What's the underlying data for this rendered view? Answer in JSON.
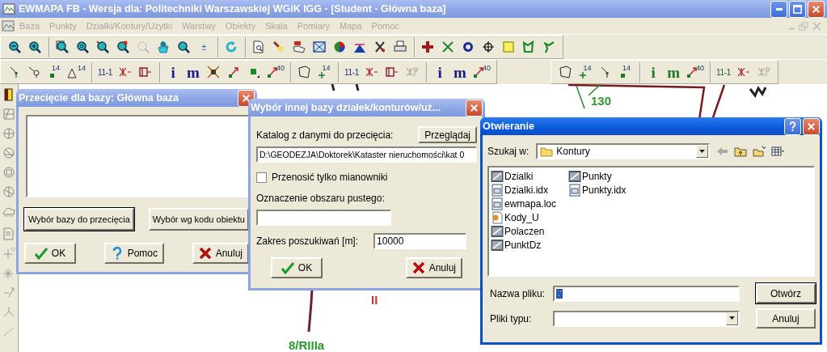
{
  "window": {
    "title": "EWMAPA FB - Wersja dla: Politechniki Warszawskiej WGiK IGG - [Student - Główna baza]",
    "active": false
  },
  "menu": [
    {
      "label": "Baza",
      "disabled": true
    },
    {
      "label": "Punkty",
      "disabled": true
    },
    {
      "label": "Działki/Kontury/Użytki",
      "disabled": true
    },
    {
      "label": "Warstwy",
      "disabled": true
    },
    {
      "label": "Obiekty",
      "disabled": true
    },
    {
      "label": "Skala",
      "disabled": true
    },
    {
      "label": "Pomiary",
      "disabled": true
    },
    {
      "label": "Mapa",
      "disabled": true
    },
    {
      "label": "Pomoc",
      "disabled": true
    }
  ],
  "toolbar_rows": [
    {
      "toolbars": [
        {
          "groups": [
            [
              {
                "kind": "zoom-out"
              },
              {
                "kind": "zoom-in"
              }
            ],
            [
              {
                "kind": "zoom-window"
              },
              {
                "kind": "zoom-circle"
              },
              {
                "kind": "zoom-pointer"
              },
              {
                "kind": "zoom-red"
              },
              {
                "kind": "zoom-disabled"
              },
              {
                "kind": "hand"
              },
              {
                "kind": "zoom-plain"
              },
              {
                "kind": "label",
                "text": "±",
                "color": "#1b5fb0"
              }
            ],
            [
              {
                "kind": "refresh"
              }
            ],
            [
              {
                "kind": "page-zoom"
              },
              {
                "kind": "brush"
              },
              {
                "kind": "map-export"
              },
              {
                "kind": "grid-map"
              },
              {
                "kind": "pie"
              },
              {
                "kind": "chart"
              },
              {
                "kind": "tool"
              },
              {
                "kind": "printer"
              }
            ],
            [
              {
                "kind": "red-cross"
              },
              {
                "kind": "green-x"
              },
              {
                "kind": "ring"
              },
              {
                "kind": "crosshair"
              },
              {
                "kind": "yellow-square"
              },
              {
                "kind": "polygon"
              },
              {
                "kind": "polyline"
              }
            ]
          ]
        }
      ]
    },
    {
      "toolbars": [
        {
          "groups": [
            [
              {
                "kind": "node-line"
              },
              {
                "kind": "node-circle"
              },
              {
                "kind": "dot",
                "text": "14"
              },
              {
                "kind": "triangle",
                "text": "14"
              }
            ],
            [
              {
                "kind": "label",
                "text": "11-1",
                "color": "#1b2f7a"
              },
              {
                "kind": "x-link"
              },
              {
                "kind": "box-link"
              }
            ],
            [
              {
                "kind": "letter",
                "text": "i",
                "color": "#1a1a8c"
              },
              {
                "kind": "letter",
                "text": "m",
                "color": "#1a1a8c"
              },
              {
                "kind": "x-node"
              },
              {
                "kind": "arrow-up"
              },
              {
                "kind": "dot-corner"
              },
              {
                "kind": "arrow-up",
                "text": "40"
              }
            ],
            [
              {
                "kind": "outline"
              },
              {
                "kind": "plus",
                "text": "14"
              }
            ],
            [
              {
                "kind": "label",
                "text": "11-1",
                "color": "#1b2f7a"
              },
              {
                "kind": "x-link"
              },
              {
                "kind": "box-link"
              },
              {
                "kind": "x-link-r"
              }
            ],
            [
              {
                "kind": "letter",
                "text": "i",
                "color": "#1a1a8c"
              },
              {
                "kind": "letter",
                "text": "m",
                "color": "#1a1a8c"
              },
              {
                "kind": "arrow-up",
                "text": "40"
              }
            ]
          ]
        },
        {
          "groups": [
            [
              {
                "kind": "outline"
              },
              {
                "kind": "plus",
                "text": "14"
              },
              {
                "kind": "node-line"
              },
              {
                "kind": "dot",
                "text": "14"
              }
            ],
            [
              {
                "kind": "letter",
                "text": "i",
                "color": "#1f7a1f"
              },
              {
                "kind": "letter",
                "text": "m",
                "color": "#1f7a1f"
              },
              {
                "kind": "arrow-up",
                "text": "40"
              }
            ],
            [
              {
                "kind": "label",
                "text": "11-1",
                "color": "#1f5a1f"
              },
              {
                "kind": "x-link"
              },
              {
                "kind": "x-link-r"
              }
            ]
          ]
        }
      ]
    }
  ],
  "map_labels": [
    {
      "text": "130",
      "color": "#2a9a2a"
    },
    {
      "text": "II",
      "color": "#d03030"
    },
    {
      "text": "8/RIIIa",
      "color": "#2a9a2a"
    }
  ],
  "intersection_dialog": {
    "title": "Przecięcie dla bazy: Główna baza",
    "active": false,
    "buttons": [
      {
        "label": "Wybór bazy do przecięcia",
        "default": true
      },
      {
        "label": "Wybór wg kodu obiektu",
        "default": false
      }
    ],
    "actions": [
      {
        "kind": "ok",
        "label": "OK"
      },
      {
        "kind": "help",
        "label": "Pomoc"
      },
      {
        "kind": "cancel",
        "label": "Anuluj"
      }
    ]
  },
  "base_dialog": {
    "title": "Wybór innej bazy działek/konturów/uż...",
    "active": false,
    "folder_label": "Katalog z danymi do przecięcia:",
    "browse_button": "Przeglądaj",
    "folder_value": "D:\\GEODEZJA\\Doktorek\\Kataster nieruchomości\\kat 0",
    "checkbox": {
      "label": "Przenosić tylko mianowniki",
      "checked": false
    },
    "empty_area_label": "Oznaczenie obszaru pustego:",
    "range_label": "Zakres poszukiwań [m]:",
    "range_value": "10000",
    "actions": [
      {
        "kind": "ok",
        "label": "OK"
      },
      {
        "kind": "cancel",
        "label": "Anuluj"
      }
    ]
  },
  "open_dialog": {
    "title": "Otwieranie",
    "active": true,
    "look_in_label": "Szukaj w:",
    "look_in_value": "Kontury",
    "files": [
      {
        "name": "Dzialki",
        "kind": "table"
      },
      {
        "name": "Dzialki.idx",
        "kind": "file"
      },
      {
        "name": "ewmapa.loc",
        "kind": "file"
      },
      {
        "name": "Kody_U",
        "kind": "script"
      },
      {
        "name": "Polaczen",
        "kind": "table"
      },
      {
        "name": "PunktDz",
        "kind": "table"
      },
      {
        "name": "Punkty",
        "kind": "table"
      },
      {
        "name": "Punkty.idx",
        "kind": "file"
      }
    ],
    "file_name_label": "Nazwa pliku:",
    "file_type_label": "Pliki typu:",
    "buttons": [
      {
        "label": "Otwórz",
        "default": true
      },
      {
        "label": "Anuluj",
        "default": false
      }
    ]
  }
}
